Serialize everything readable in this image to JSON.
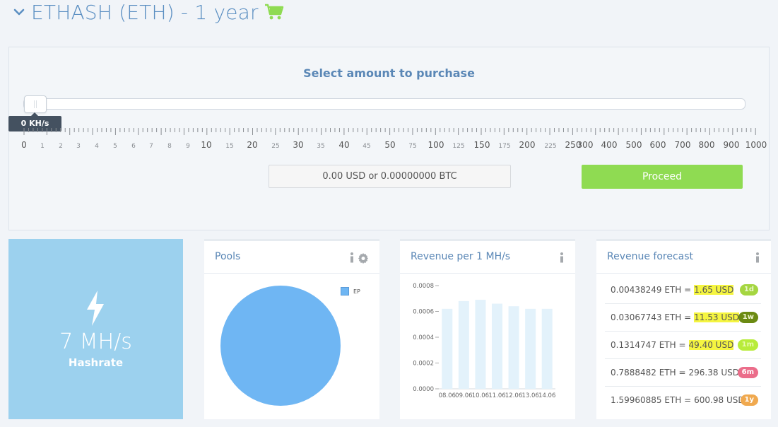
{
  "header": {
    "title": "ETHASH (ETH) - 1 year",
    "title_color": "#5b8fc2",
    "cart_color": "#8fdb52"
  },
  "purchase": {
    "heading": "Select amount to purchase",
    "slider_value_label": "0 KH/s",
    "slider_fraction": 0,
    "scale_labels": [
      "0",
      "1",
      "2",
      "3",
      "4",
      "5",
      "6",
      "7",
      "8",
      "9",
      "10",
      "15",
      "20",
      "25",
      "30",
      "35",
      "40",
      "45",
      "50",
      "75",
      "100",
      "125",
      "150",
      "175",
      "200",
      "225",
      "250",
      "300",
      "400",
      "500",
      "600",
      "700",
      "800",
      "900",
      "1000"
    ],
    "price_text": "0.00 USD or 0.00000000 BTC",
    "proceed_label": "Proceed",
    "proceed_color": "#8fdb52"
  },
  "hashrate": {
    "value": "7 MH/s",
    "label": "Hashrate",
    "bg_color": "#9cd1ee"
  },
  "pools": {
    "title": "Pools",
    "legend_label": "EP",
    "slice_color": "#6fb6f3"
  },
  "revenue": {
    "title": "Revenue per 1 MH/s",
    "chart_data": {
      "type": "bar",
      "categories": [
        "08.06",
        "09.06",
        "10.06",
        "11.06",
        "12.06",
        "13.06",
        "14.06"
      ],
      "values": [
        0.00062,
        0.00068,
        0.00069,
        0.00066,
        0.00064,
        0.00062,
        0.00062
      ],
      "ylim": [
        0,
        0.0008
      ],
      "yticks": [
        "0.0008",
        "0.0006",
        "0.0004",
        "0.0002",
        "0.0000"
      ],
      "bar_color": "#e3f2fb"
    }
  },
  "forecast": {
    "title": "Revenue forecast",
    "rows": [
      {
        "eth": "0.00438249 ETH =",
        "usd": "1.65 USD",
        "badge": "1d"
      },
      {
        "eth": "0.03067743 ETH =",
        "usd": "11.53 USD",
        "badge": "1w"
      },
      {
        "eth": "0.1314747 ETH =",
        "usd": "49.40 USD",
        "badge": "1m"
      },
      {
        "eth": "0.7888482 ETH =",
        "usd": "296.38 USD",
        "badge": "6m"
      },
      {
        "eth": "1.59960885 ETH =",
        "usd": "600.98 USD",
        "badge": "1y"
      }
    ]
  }
}
